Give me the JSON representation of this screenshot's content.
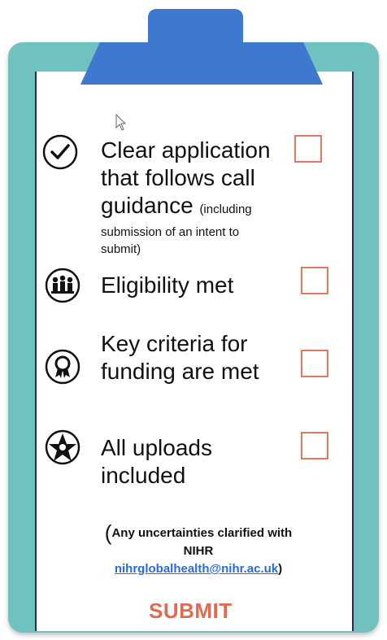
{
  "checklist": {
    "items": [
      {
        "title": "Clear application that follows call guidance",
        "title_line1": "Clear application",
        "title_line2": "that follows call",
        "title_line3": "guidance",
        "note_inline": "(including",
        "note_line1": "submission of an intent to",
        "note_line2": "submit)",
        "icon": "checkmark-icon"
      },
      {
        "title": "Eligibility met",
        "icon": "people-icon"
      },
      {
        "title": "Key criteria for funding are met",
        "title_line1": "Key criteria for",
        "title_line2": "funding are met",
        "icon": "award-ribbon-icon"
      },
      {
        "title": "All uploads included",
        "title_line1": "All uploads",
        "title_line2": "included",
        "icon": "network-star-icon"
      }
    ],
    "footer": {
      "open_paren": "(",
      "line1": "Any uncertainties clarified with",
      "line2": "NIHR",
      "email": "nihrglobalhealth@nihr.ac.uk",
      "close_paren": ")"
    },
    "submit_label": "SUBMIT"
  },
  "colors": {
    "board": "#6fc2c0",
    "clip": "#3f78cf",
    "checkbox_border": "#e07a5f",
    "submit": "#e06b4f",
    "link": "#2a6bd8"
  }
}
